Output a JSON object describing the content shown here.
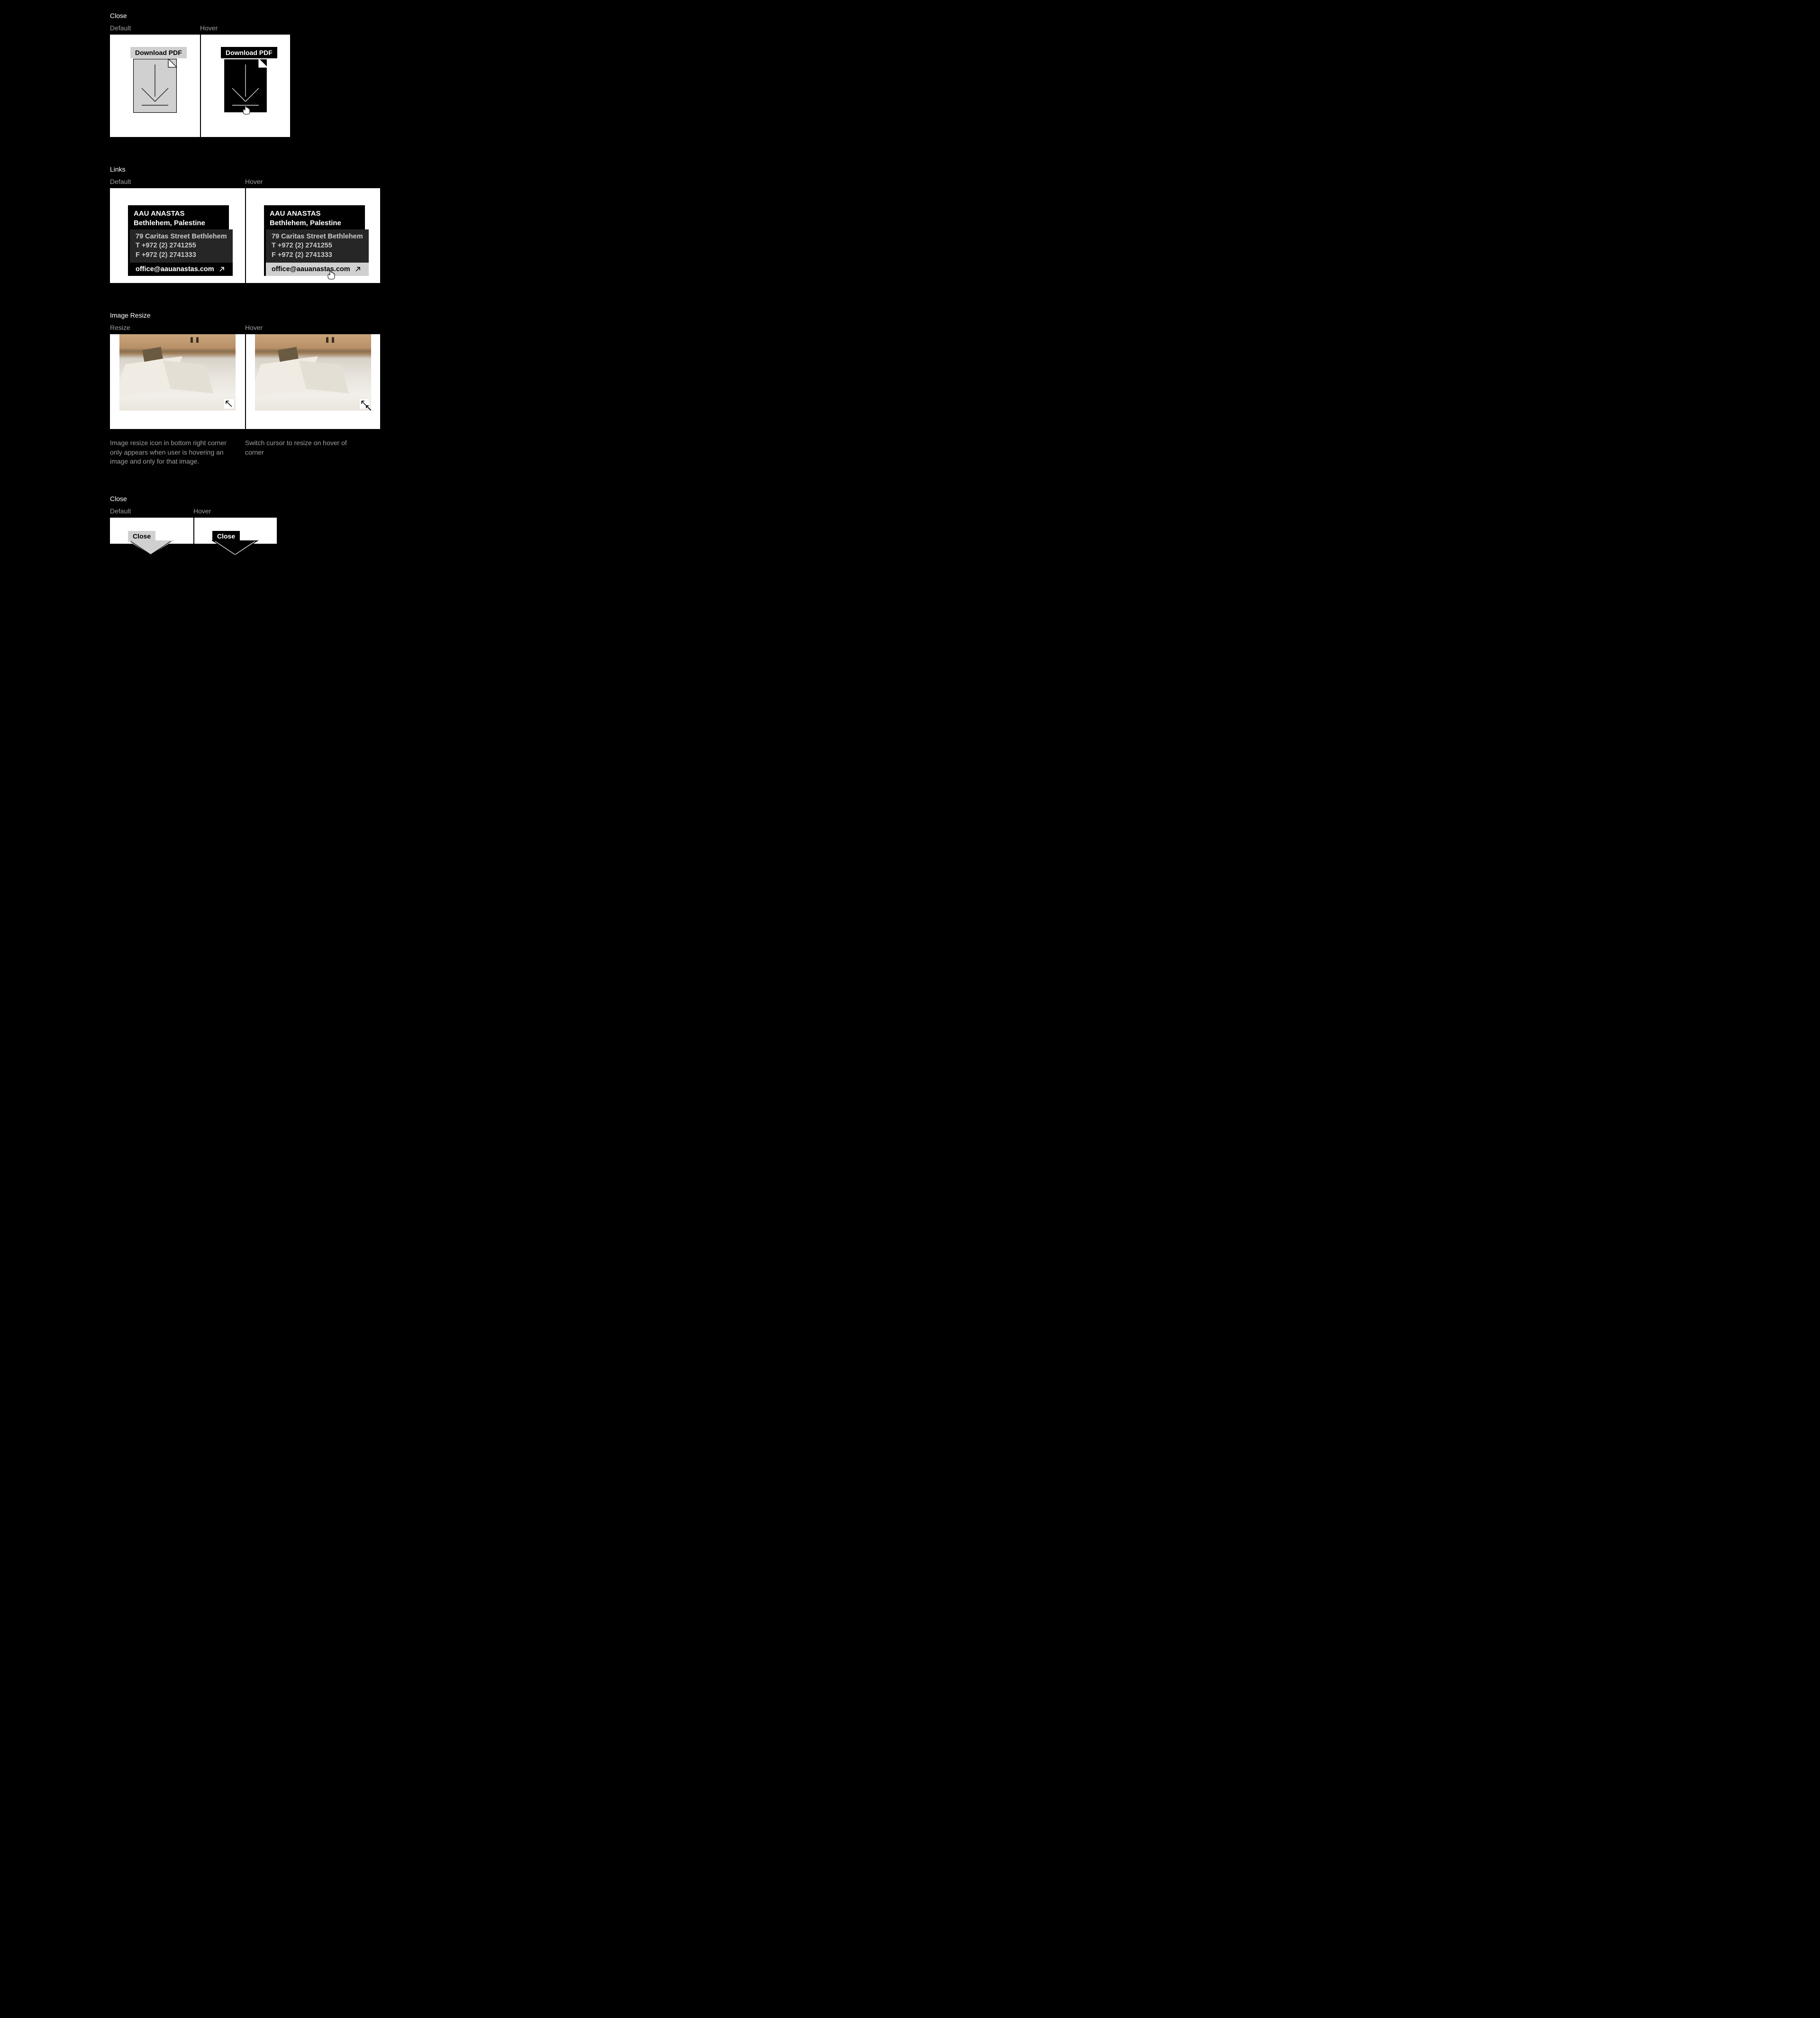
{
  "sections": {
    "downloadPdf": {
      "title": "Close",
      "labels": {
        "default": "Default",
        "hover": "Hover"
      },
      "button": "Download PDF"
    },
    "links": {
      "title": "Links",
      "labels": {
        "default": "Default",
        "hover": "Hover"
      },
      "card": {
        "name": "AAU ANASTAS",
        "location": "Bethlehem, Palestine",
        "address": "79 Caritas Street Bethlehem",
        "tel": "T +972 (2) 2741255",
        "fax": "F +972 (2) 2741333",
        "email": "office@aauanastas.com"
      }
    },
    "imageResize": {
      "title": "Image Resize",
      "labels": {
        "resize": "Resize",
        "hover": "Hover"
      },
      "captions": {
        "left": "Image resize icon in bottom right corner only appears when user is hovering an image and only for that image.",
        "right": "Switch cursor to resize on hover of corner"
      }
    },
    "close": {
      "title": "Close",
      "labels": {
        "default": "Default",
        "hover": "Hover"
      },
      "button": "Close"
    }
  }
}
